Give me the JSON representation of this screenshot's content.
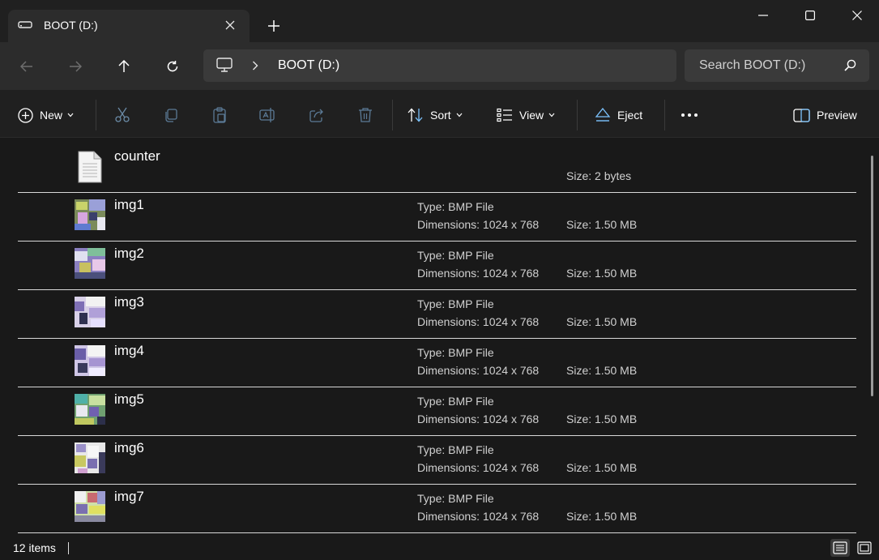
{
  "window": {
    "tab_title": "BOOT (D:)",
    "icons": [
      "drive-icon",
      "close-tab-icon",
      "new-tab-icon",
      "minimize-icon",
      "maximize-icon",
      "close-window-icon"
    ]
  },
  "nav": {
    "icons": [
      "back-arrow-icon",
      "forward-arrow-icon",
      "up-arrow-icon",
      "refresh-icon"
    ],
    "address_location": "BOOT (D:)",
    "search_placeholder": "Search BOOT (D:)"
  },
  "commands": {
    "new_label": "New",
    "sort_label": "Sort",
    "view_label": "View",
    "eject_label": "Eject",
    "preview_label": "Preview",
    "icons": [
      "cut-icon",
      "copy-icon",
      "paste-icon",
      "rename-icon",
      "share-icon",
      "delete-icon",
      "more-icon"
    ]
  },
  "files": [
    {
      "name": "counter",
      "type": "",
      "dimensions": "",
      "size": "Size: 2 bytes",
      "kind": "text"
    },
    {
      "name": "img1",
      "type": "Type: BMP File",
      "dimensions": "Dimensions: 1024 x 768",
      "size": "Size: 1.50 MB",
      "kind": "image"
    },
    {
      "name": "img2",
      "type": "Type: BMP File",
      "dimensions": "Dimensions: 1024 x 768",
      "size": "Size: 1.50 MB",
      "kind": "image"
    },
    {
      "name": "img3",
      "type": "Type: BMP File",
      "dimensions": "Dimensions: 1024 x 768",
      "size": "Size: 1.50 MB",
      "kind": "image"
    },
    {
      "name": "img4",
      "type": "Type: BMP File",
      "dimensions": "Dimensions: 1024 x 768",
      "size": "Size: 1.50 MB",
      "kind": "image"
    },
    {
      "name": "img5",
      "type": "Type: BMP File",
      "dimensions": "Dimensions: 1024 x 768",
      "size": "Size: 1.50 MB",
      "kind": "image"
    },
    {
      "name": "img6",
      "type": "Type: BMP File",
      "dimensions": "Dimensions: 1024 x 768",
      "size": "Size: 1.50 MB",
      "kind": "image"
    },
    {
      "name": "img7",
      "type": "Type: BMP File",
      "dimensions": "Dimensions: 1024 x 768",
      "size": "Size: 1.50 MB",
      "kind": "image"
    }
  ],
  "status": {
    "item_count": "12 items",
    "view_modes": [
      "details-view-icon",
      "tiles-view-icon"
    ]
  },
  "colors": {
    "background": "#191919",
    "titlebar": "#202020",
    "tab": "#2c2c2c",
    "accent_eject": "#7cc4ff"
  }
}
